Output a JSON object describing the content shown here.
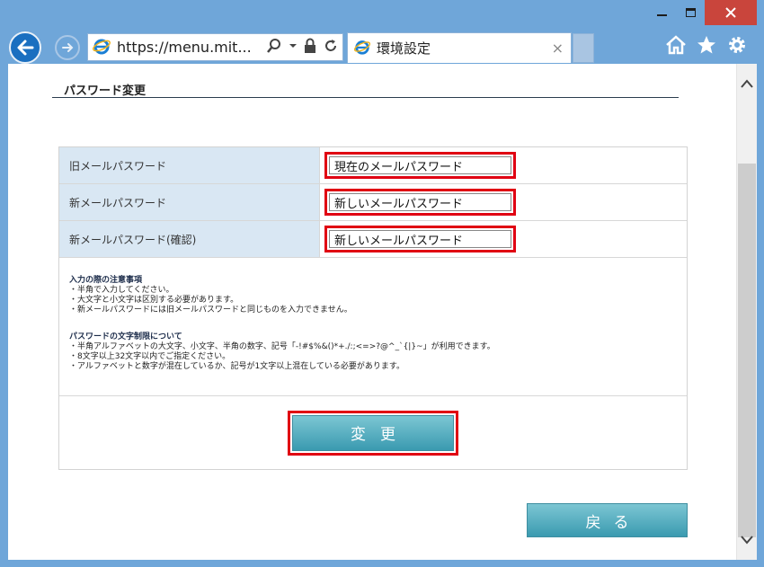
{
  "browser": {
    "address_url": "https://menu.mit...",
    "tab_title": "環境設定",
    "tab_close": "×"
  },
  "page": {
    "section_title": "パスワード変更",
    "fields": [
      {
        "label": "旧メールパスワード",
        "value": "現在のメールパスワード"
      },
      {
        "label": "新メールパスワード",
        "value": "新しいメールパスワード"
      },
      {
        "label": "新メールパスワード(確認)",
        "value": "新しいメールパスワード"
      }
    ],
    "notes": {
      "input_heading": "入力の際の注意事項",
      "input_lines": [
        "・半角で入力してください。",
        "・大文字と小文字は区別する必要があります。",
        "・新メールパスワードには旧メールパスワードと同じものを入力できません。"
      ],
      "limit_heading": "パスワードの文字制限について",
      "limit_lines": [
        "・半角アルファベットの大文字、小文字、半角の数字、記号「-!#$%&()*+./:;<=>?@^_`{|}~」が利用できます。",
        "・8文字以上32文字以内でご指定ください。",
        "・アルファベットと数字が混在しているか、記号が1文字以上混在している必要があります。"
      ]
    },
    "change_button": "変更",
    "back_button": "戻る"
  },
  "colors": {
    "accent_button": "#4aa8bd",
    "highlight_red": "#e00012",
    "label_bg": "#d9e7f3",
    "window_frame": "#6fa6d9"
  }
}
